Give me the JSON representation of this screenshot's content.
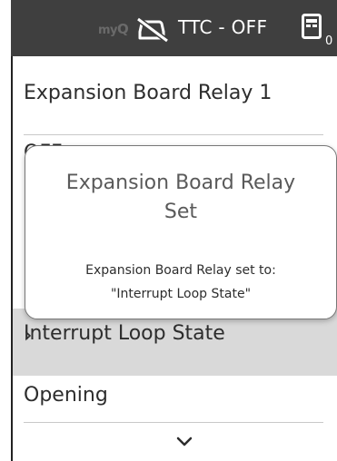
{
  "status_bar": {
    "logo": {
      "my": "my",
      "q": "Q"
    },
    "car_icon": "car-off-icon",
    "ttc_status": "TTC - OFF",
    "device_icon": "device-panel-icon",
    "device_count": "0"
  },
  "menu": {
    "title": "Expansion Board Relay 1",
    "items": [
      {
        "label": "OFF"
      },
      {
        "label": "Interrupt Loop State",
        "selected": true
      },
      {
        "label": "Opening"
      }
    ],
    "chevron_right": "›",
    "scroll_icon": "chevron-down-icon"
  },
  "dialog": {
    "title_line1": "Expansion Board Relay",
    "title_line2": "Set",
    "message_line1": "Expansion Board Relay set to:",
    "message_line2": "\"Interrupt Loop State\""
  },
  "colors": {
    "status_bar_bg": "#3f3f3f",
    "selected_row_bg": "#d9d9d9",
    "text": "#2d2d2d"
  }
}
